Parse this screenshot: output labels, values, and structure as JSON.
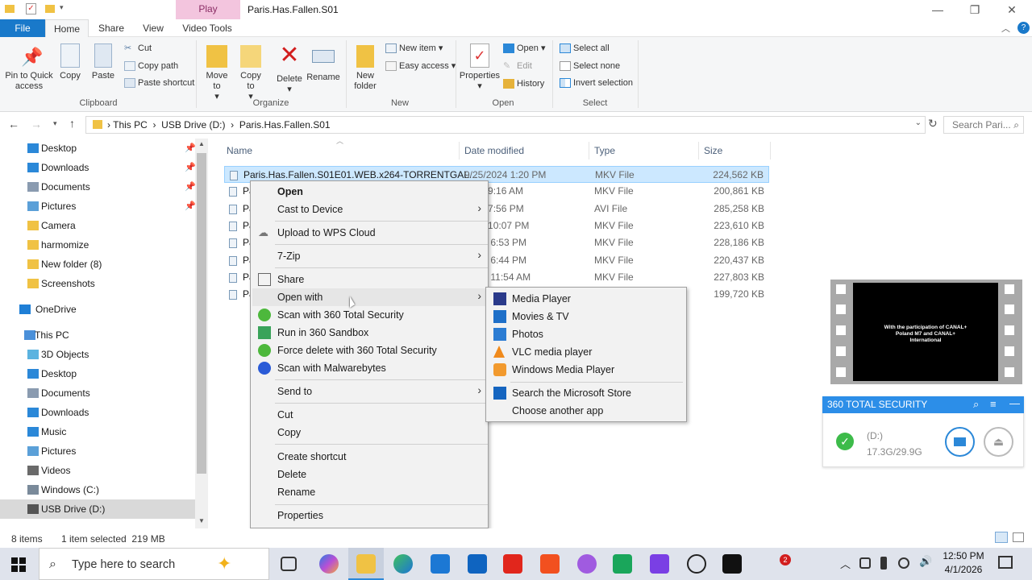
{
  "window": {
    "contextual_tab": "Play",
    "title": "Paris.Has.Fallen.S01"
  },
  "ribbon": {
    "tabs": [
      "File",
      "Home",
      "Share",
      "View",
      "Video Tools"
    ],
    "clipboard": {
      "group_label": "Clipboard",
      "pin_label": "Pin to Quick access",
      "copy_label": "Copy",
      "paste_label": "Paste",
      "cut_label": "Cut",
      "copy_path_label": "Copy path",
      "paste_shortcut_label": "Paste shortcut"
    },
    "organize": {
      "group_label": "Organize",
      "move_to_label": "Move to",
      "copy_to_label": "Copy to",
      "delete_label": "Delete",
      "rename_label": "Rename"
    },
    "new": {
      "group_label": "New",
      "new_folder_label": "New folder",
      "new_item_label": "New item",
      "easy_access_label": "Easy access"
    },
    "open": {
      "group_label": "Open",
      "properties_label": "Properties",
      "open_label": "Open",
      "edit_label": "Edit",
      "history_label": "History"
    },
    "select": {
      "group_label": "Select",
      "select_all_label": "Select all",
      "select_none_label": "Select none",
      "invert_label": "Invert selection"
    }
  },
  "address": {
    "crumbs": [
      "This PC",
      "USB Drive (D:)",
      "Paris.Has.Fallen.S01"
    ],
    "search_placeholder": "Search Pari..."
  },
  "nav": {
    "items": [
      {
        "label": "Desktop",
        "pinned": true,
        "color": "#2b88d8"
      },
      {
        "label": "Downloads",
        "pinned": true,
        "color": "#2b88d8"
      },
      {
        "label": "Documents",
        "pinned": true,
        "color": "#8a9bb0"
      },
      {
        "label": "Pictures",
        "pinned": true,
        "color": "#5ba0d8"
      },
      {
        "label": "Camera",
        "pinned": false,
        "color": "#f0c244"
      },
      {
        "label": "harmomize",
        "pinned": false,
        "color": "#f0c244"
      },
      {
        "label": "New folder (8)",
        "pinned": false,
        "color": "#f0c244"
      },
      {
        "label": "Screenshots",
        "pinned": false,
        "color": "#f0c244"
      },
      {
        "label": "OneDrive",
        "pinned": false,
        "color": "#1f7fd6"
      },
      {
        "label": "This PC",
        "pinned": false,
        "color": "#4a90d9"
      },
      {
        "label": "3D Objects",
        "pinned": false,
        "color": "#5bb3e0"
      },
      {
        "label": "Desktop",
        "pinned": false,
        "color": "#2b88d8"
      },
      {
        "label": "Documents",
        "pinned": false,
        "color": "#8a9bb0"
      },
      {
        "label": "Downloads",
        "pinned": false,
        "color": "#2b88d8"
      },
      {
        "label": "Music",
        "pinned": false,
        "color": "#2b88d8"
      },
      {
        "label": "Pictures",
        "pinned": false,
        "color": "#5ba0d8"
      },
      {
        "label": "Videos",
        "pinned": false,
        "color": "#6a6a6a"
      },
      {
        "label": "Windows (C:)",
        "pinned": false,
        "color": "#7a8a9a"
      },
      {
        "label": "USB Drive (D:)",
        "pinned": false,
        "color": "#555555"
      }
    ]
  },
  "columns": {
    "name": "Name",
    "date": "Date modified",
    "type": "Type",
    "size": "Size"
  },
  "files": [
    {
      "name": "Paris.Has.Fallen.S01E01.WEB.x264-TORRENTGAL...",
      "date": "9/25/2024 1:20 PM",
      "type": "MKV File",
      "size": "224,562 KB"
    },
    {
      "name": "Pa",
      "date": "2024 9:16 AM",
      "type": "MKV File",
      "size": "200,861 KB"
    },
    {
      "name": "Pa",
      "date": "2024 7:56 PM",
      "type": "AVI File",
      "size": "285,258 KB"
    },
    {
      "name": "Pa",
      "date": "2024 10:07 PM",
      "type": "MKV File",
      "size": "223,610 KB"
    },
    {
      "name": "Pa",
      "date": "/2024 6:53 PM",
      "type": "MKV File",
      "size": "228,186 KB"
    },
    {
      "name": "Pa",
      "date": "/2024 6:44 PM",
      "type": "MKV File",
      "size": "220,437 KB"
    },
    {
      "name": "Pa",
      "date": "/2024 11:54 AM",
      "type": "MKV File",
      "size": "227,803 KB"
    },
    {
      "name": "Pa",
      "date": "",
      "type": "",
      "size": "199,720 KB"
    }
  ],
  "context_menu": {
    "open": "Open",
    "cast": "Cast to Device",
    "wps": "Upload to WPS Cloud",
    "zip": "7-Zip",
    "share": "Share",
    "open_with": "Open with",
    "scan360": "Scan with 360 Total Security",
    "sandbox": "Run in 360 Sandbox",
    "force_delete": "Force delete with 360 Total Security",
    "malwarebytes": "Scan with Malwarebytes",
    "send_to": "Send to",
    "cut": "Cut",
    "copy": "Copy",
    "create_shortcut": "Create shortcut",
    "delete": "Delete",
    "rename": "Rename",
    "properties": "Properties"
  },
  "open_with_menu": {
    "media_player": "Media Player",
    "movies_tv": "Movies & TV",
    "photos": "Photos",
    "vlc": "VLC media player",
    "wmp": "Windows Media Player",
    "store": "Search the Microsoft Store",
    "another": "Choose another app"
  },
  "preview": {
    "caption": "With the participation of CANAL+ Poland M7 and CANAL+ International"
  },
  "security_widget": {
    "title": "360 TOTAL SECURITY",
    "drive": "(D:)",
    "usage": "17.3G/29.9G"
  },
  "status": {
    "items": "8 items",
    "selected": "1 item selected  219 MB"
  },
  "taskbar": {
    "search_placeholder": "Type here to search",
    "time": "12:50 PM",
    "date": "4/1/2026",
    "badge_count": "2"
  }
}
